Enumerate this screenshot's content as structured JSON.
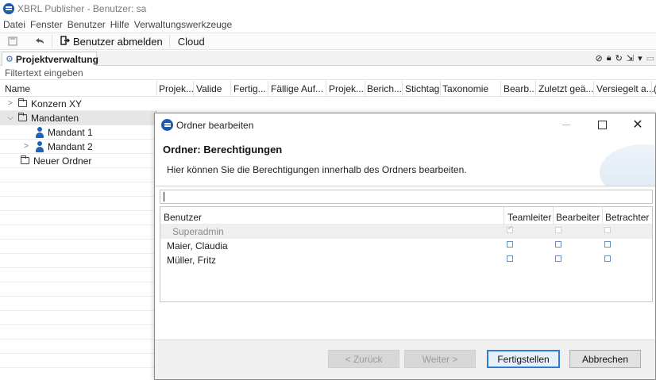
{
  "window": {
    "title": "XBRL Publisher - Benutzer: sa"
  },
  "menu": [
    "Datei",
    "Fenster",
    "Benutzer",
    "Hilfe",
    "Verwaltungswerkzeuge"
  ],
  "toolbar": {
    "logout_label": "Benutzer abmelden",
    "cloud_label": "Cloud"
  },
  "view": {
    "tab_label": "Projektverwaltung",
    "filter_placeholder": "Filtertext eingeben"
  },
  "columns": [
    "Name",
    "Projek...",
    "Valide",
    "Fertig...",
    "Fällige Auf...",
    "Projek...",
    "Berich...",
    "Stichtag",
    "Taxonomie",
    "Bearb...",
    "Zuletzt geä...",
    "Versiegelt a...",
    "("
  ],
  "tree": [
    {
      "label": "Konzern XY",
      "type": "folder",
      "expanded": false,
      "level": 0
    },
    {
      "label": "Mandanten",
      "type": "folder",
      "expanded": true,
      "level": 0,
      "selected": true
    },
    {
      "label": "Mandant 1",
      "type": "user",
      "level": 1
    },
    {
      "label": "Mandant 2",
      "type": "user",
      "expanded": false,
      "level": 1
    },
    {
      "label": "Neuer Ordner",
      "type": "folder",
      "level": 0
    }
  ],
  "dialog": {
    "title": "Ordner bearbeiten",
    "heading": "Ordner: Berechtigungen",
    "description": "Hier können Sie die Berechtigungen innerhalb des Ordners bearbeiten.",
    "search_value": "",
    "table": {
      "headers": [
        "Benutzer",
        "Teamleiter",
        "Bearbeiter",
        "Betrachter"
      ],
      "rows": [
        {
          "user": "Superadmin",
          "disabled": true,
          "teamleiter": true,
          "bearbeiter": false,
          "betrachter": false
        },
        {
          "user": "Maier, Claudia",
          "disabled": false,
          "teamleiter": false,
          "bearbeiter": false,
          "betrachter": false
        },
        {
          "user": "Müller, Fritz",
          "disabled": false,
          "teamleiter": false,
          "bearbeiter": false,
          "betrachter": false
        }
      ]
    },
    "buttons": {
      "back": "< Zurück",
      "next": "Weiter >",
      "finish": "Fertigstellen",
      "cancel": "Abbrechen"
    }
  },
  "colors": {
    "accent": "#1e5aa8",
    "focus_border": "#2f7bd6",
    "selection": "#e6e6e6"
  }
}
